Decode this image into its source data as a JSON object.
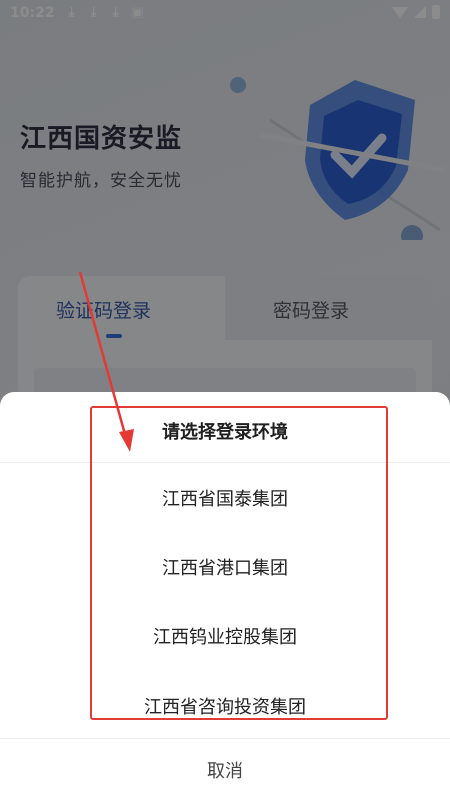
{
  "status_bar": {
    "time": "10:22",
    "notification_icons": [
      "download-icon",
      "download-icon",
      "download-icon",
      "photo-icon"
    ],
    "right_icons": [
      "wifi-icon",
      "signal-icon",
      "battery-charging-icon"
    ]
  },
  "app": {
    "title": "江西国资安监",
    "subtitle": "智能护航，安全无忧",
    "tabs": [
      {
        "label": "验证码登录",
        "active": true
      },
      {
        "label": "密码登录",
        "active": false
      }
    ]
  },
  "sheet": {
    "title": "请选择登录环境",
    "options": [
      {
        "label": "江西省国泰集团"
      },
      {
        "label": "江西省港口集团"
      },
      {
        "label": "江西钨业控股集团"
      },
      {
        "label": "江西省咨询投资集团"
      }
    ],
    "cancel_label": "取消"
  },
  "colors": {
    "accent": "#3a6fd8",
    "annotation": "#e43a36",
    "overlay": "rgba(0,0,0,0.45)"
  }
}
